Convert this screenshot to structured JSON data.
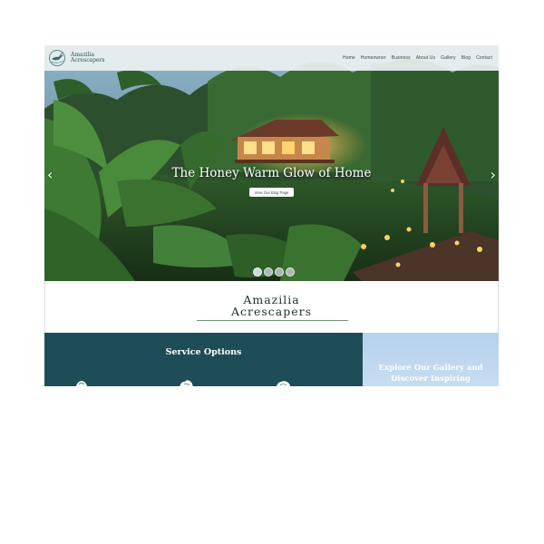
{
  "header": {
    "logo": {
      "line1": "Amazilia",
      "line2": "Acrescapers"
    },
    "nav": [
      {
        "id": "home",
        "label": "Home"
      },
      {
        "id": "homeowner",
        "label": "Homeowner"
      },
      {
        "id": "business",
        "label": "Business"
      },
      {
        "id": "about",
        "label": "About Us"
      },
      {
        "id": "gallery",
        "label": "Gallery"
      },
      {
        "id": "blog",
        "label": "Blog"
      },
      {
        "id": "contact",
        "label": "Contact"
      }
    ]
  },
  "hero": {
    "title": "The Honey Warm Glow of Home",
    "button_label": "View Our Blog Page",
    "prev_arrow": "‹",
    "next_arrow": "›",
    "slide_count": 4,
    "active_slide": 1
  },
  "brand": {
    "line1": "Amazilia",
    "line2": "Acrescapers",
    "accent_color": "#6f9173"
  },
  "services": {
    "title": "Service Options",
    "background": "#1e4d57",
    "icons": [
      "flower-icon",
      "flower-icon",
      "flower-icon"
    ]
  },
  "gallery_promo": {
    "line1": "Explore Our Gallery and",
    "line2": "Discover Inspiring"
  }
}
